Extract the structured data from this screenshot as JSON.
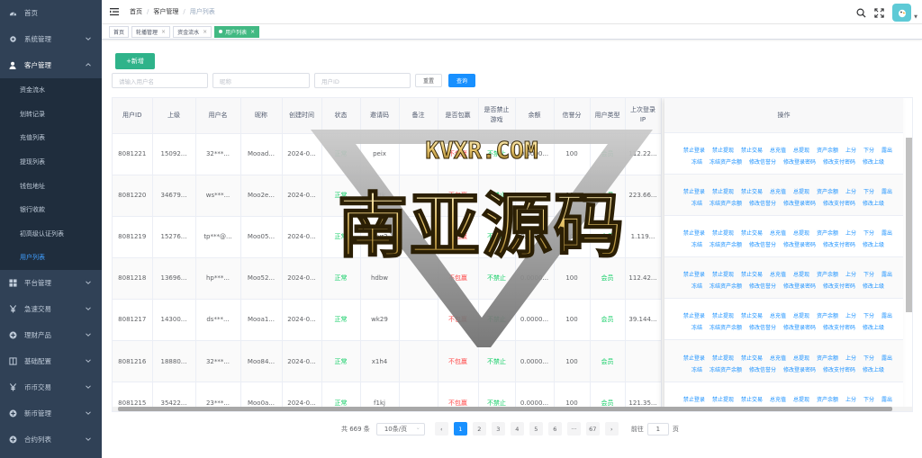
{
  "sidebar": {
    "items": [
      {
        "label": "首页",
        "icon": "dashboard-icon",
        "arrow": false
      },
      {
        "label": "系统管理",
        "icon": "gear-icon",
        "arrow": true
      },
      {
        "label": "客户管理",
        "icon": "user-icon",
        "arrow": true,
        "open": true
      }
    ],
    "sub_items": [
      {
        "label": "资金流水"
      },
      {
        "label": "划转记录"
      },
      {
        "label": "充值列表"
      },
      {
        "label": "提现列表"
      },
      {
        "label": "钱包地址"
      },
      {
        "label": "银行收款"
      },
      {
        "label": "初高级认证列表"
      },
      {
        "label": "用户列表",
        "active": true
      }
    ],
    "items_after": [
      {
        "label": "平台管理",
        "icon": "grid-icon"
      },
      {
        "label": "急速交易",
        "icon": "yen-icon"
      },
      {
        "label": "理财产品",
        "icon": "plus-circle-icon"
      },
      {
        "label": "基础配置",
        "icon": "book-icon"
      },
      {
        "label": "币币交易",
        "icon": "yen-icon"
      },
      {
        "label": "新币管理",
        "icon": "plus-circle-icon"
      },
      {
        "label": "合约列表",
        "icon": "plus-circle-icon"
      }
    ]
  },
  "breadcrumb": {
    "home": "首页",
    "section": "客户管理",
    "page": "用户列表"
  },
  "tabs": [
    {
      "label": "首页",
      "closable": false
    },
    {
      "label": "轮播管理",
      "closable": true
    },
    {
      "label": "资金流水",
      "closable": true
    },
    {
      "label": "用户列表",
      "closable": true,
      "active": true
    }
  ],
  "toolbar": {
    "add_label": "+新增",
    "reset_label": "重置",
    "search_label": "查询"
  },
  "filters": {
    "username_placeholder": "请输入用户名",
    "nickname_placeholder": "昵称",
    "userid_placeholder": "用户ID"
  },
  "table": {
    "columns": [
      "用户ID",
      "上级",
      "用户名",
      "昵称",
      "创建时间",
      "状态",
      "邀请码",
      "备注",
      "是否包赢",
      "是否禁止游戏",
      "余额",
      "信誉分",
      "用户类型",
      "上次登录IP"
    ],
    "ops_header": "操作",
    "rows": [
      {
        "id": "8081221",
        "parent": "15092...",
        "username": "32***...",
        "nickname": "Mooad...",
        "created": "2024-0...",
        "status": "正常",
        "invite": "peix",
        "remark": "",
        "win": "不包赢",
        "ban": "不禁止",
        "balance": "0.0000...",
        "credit": "100",
        "type": "会员",
        "ip": "112.22..."
      },
      {
        "id": "8081220",
        "parent": "34679...",
        "username": "ws***...",
        "nickname": "Moo2e...",
        "created": "2024-0...",
        "status": "正常",
        "invite": "l7tk",
        "remark": "",
        "win": "不包赢",
        "ban": "不禁止",
        "balance": "0.0000...",
        "credit": "100",
        "type": "会员",
        "ip": "223.66..."
      },
      {
        "id": "8081219",
        "parent": "15276...",
        "username": "tp***@...",
        "nickname": "Moo05...",
        "created": "2024-0...",
        "status": "正常",
        "invite": "mvr2",
        "remark": "",
        "win": "不包赢",
        "ban": "不禁止",
        "balance": "0.0000...",
        "credit": "100",
        "type": "会员",
        "ip": "1.119..."
      },
      {
        "id": "8081218",
        "parent": "13696...",
        "username": "hp***...",
        "nickname": "Moo52...",
        "created": "2024-0...",
        "status": "正常",
        "invite": "hdbw",
        "remark": "",
        "win": "不包赢",
        "ban": "不禁止",
        "balance": "0.0000...",
        "credit": "100",
        "type": "会员",
        "ip": "112.42..."
      },
      {
        "id": "8081217",
        "parent": "14300...",
        "username": "ds***...",
        "nickname": "Mooa1...",
        "created": "2024-0...",
        "status": "正常",
        "invite": "wk29",
        "remark": "",
        "win": "不包赢",
        "ban": "不禁止",
        "balance": "0.0000...",
        "credit": "100",
        "type": "会员",
        "ip": "39.144..."
      },
      {
        "id": "8081216",
        "parent": "18880...",
        "username": "32***...",
        "nickname": "Moo84...",
        "created": "2024-0...",
        "status": "正常",
        "invite": "x1h4",
        "remark": "",
        "win": "不包赢",
        "ban": "不禁止",
        "balance": "0.0000...",
        "credit": "100",
        "type": "会员",
        "ip": ""
      },
      {
        "id": "8081215",
        "parent": "35422...",
        "username": "23***...",
        "nickname": "Moo0a...",
        "created": "2024-0...",
        "status": "正常",
        "invite": "f1kj",
        "remark": "",
        "win": "不包赢",
        "ban": "不禁止",
        "balance": "0.0000...",
        "credit": "100",
        "type": "会员",
        "ip": "121.35..."
      }
    ],
    "ops_line1": [
      "禁止登录",
      "禁止提现",
      "禁止交易",
      "总充值",
      "总提现",
      "资产余额",
      "上分",
      "下分",
      "露出"
    ],
    "ops_line2": [
      "冻结",
      "冻结资产余额",
      "修改信誉分",
      "修改登录密码",
      "修改支付密码",
      "修改上级"
    ]
  },
  "pagination": {
    "total": "共 669 条",
    "page_size": "10条/页",
    "pages": [
      "1",
      "2",
      "3",
      "4",
      "5",
      "6",
      "···",
      "67"
    ],
    "current": "1",
    "goto_label": "前往",
    "goto_value": "1",
    "page_suffix": "页"
  },
  "watermark": {
    "line1": "KVXR.COM",
    "line2": "南亚源码"
  },
  "colors": {
    "sidebar_bg": "#304156",
    "accent": "#1890ff",
    "add_button": "#2fb38a",
    "active_tag": "#42b983",
    "ok_green": "#13ce66",
    "red": "#ff4949"
  }
}
